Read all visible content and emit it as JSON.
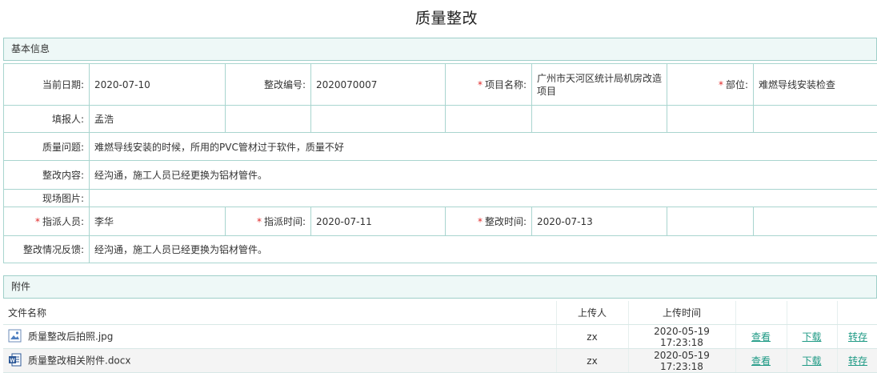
{
  "title": "质量整改",
  "basic": {
    "section_title": "基本信息",
    "date_label": "当前日期:",
    "date_value": "2020-07-10",
    "code_label": "整改编号:",
    "code_value": "2020070007",
    "project_label": "项目名称:",
    "project_value": "广州市天河区统计局机房改造项目",
    "part_label": "部位:",
    "part_value": "难燃导线安装检查",
    "reporter_label": "填报人:",
    "reporter_value": "孟浩",
    "issue_label": "质量问题:",
    "issue_value": "难燃导线安装的时候，所用的PVC管材过于软件，质量不好",
    "content_label": "整改内容:",
    "content_value": "经沟通，施工人员已经更换为铝材管件。",
    "photo_label": "现场图片:",
    "assignee_label": "指派人员:",
    "assignee_value": "李华",
    "assign_time_label": "指派时间:",
    "assign_time_value": "2020-07-11",
    "fix_time_label": "整改时间:",
    "fix_time_value": "2020-07-13",
    "feedback_label": "整改情况反馈:",
    "feedback_value": "经沟通，施工人员已经更换为铝材管件。"
  },
  "attachments": {
    "section_title": "附件",
    "columns": {
      "name": "文件名称",
      "uploader": "上传人",
      "time": "上传时间"
    },
    "files": [
      {
        "icon": "image-file-icon",
        "name": "质量整改后拍照.jpg",
        "uploader": "zx",
        "time": "2020-05-19 17:23:18",
        "view": "查看",
        "download": "下载",
        "save": "转存"
      },
      {
        "icon": "word-file-icon",
        "name": "质量整改相关附件.docx",
        "uploader": "zx",
        "time": "2020-05-19 17:23:18",
        "view": "查看",
        "download": "下载",
        "save": "转存"
      }
    ]
  },
  "colors": {
    "accent": "#1f9a85",
    "required": "#e02828",
    "border": "#a9d5cf",
    "section_bg": "#eef8f7"
  }
}
